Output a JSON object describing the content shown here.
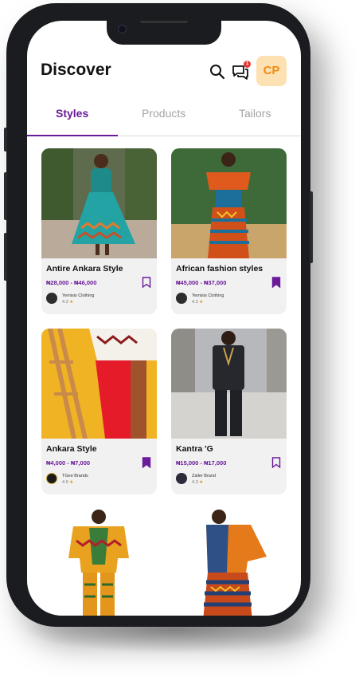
{
  "header": {
    "title": "Discover",
    "avatar_initials": "CP",
    "chat_badge": "1"
  },
  "tabs": [
    {
      "label": "Styles",
      "active": true
    },
    {
      "label": "Products",
      "active": false
    },
    {
      "label": "Tailors",
      "active": false
    }
  ],
  "cards": [
    {
      "name": "Antire Ankara Style",
      "price": "₦28,000 - ₦46,000",
      "seller": "Yemisis Clothing",
      "rating": "4.3",
      "bookmarked": false
    },
    {
      "name": "African fashion styles",
      "price": "₦45,000 - ₦37,000",
      "seller": "Yemisis Clothing",
      "rating": "4.3",
      "bookmarked": true
    },
    {
      "name": "Ankara Style",
      "price": "₦4,000 - ₦7,000",
      "seller": "TGee Brands",
      "rating": "4.9",
      "bookmarked": true
    },
    {
      "name": "Kantra 'G",
      "price": "₦15,000 - ₦17,000",
      "seller": "Zailer Brand",
      "rating": "4.3",
      "bookmarked": false
    }
  ],
  "colors": {
    "accent": "#6a1b9a",
    "star": "#f28a13",
    "avatar_bg": "#fde1b2",
    "avatar_text": "#f28a13"
  },
  "icons": {
    "search": "search-icon",
    "chat": "chat-icon",
    "bookmark": "bookmark-icon",
    "star": "star-icon"
  }
}
